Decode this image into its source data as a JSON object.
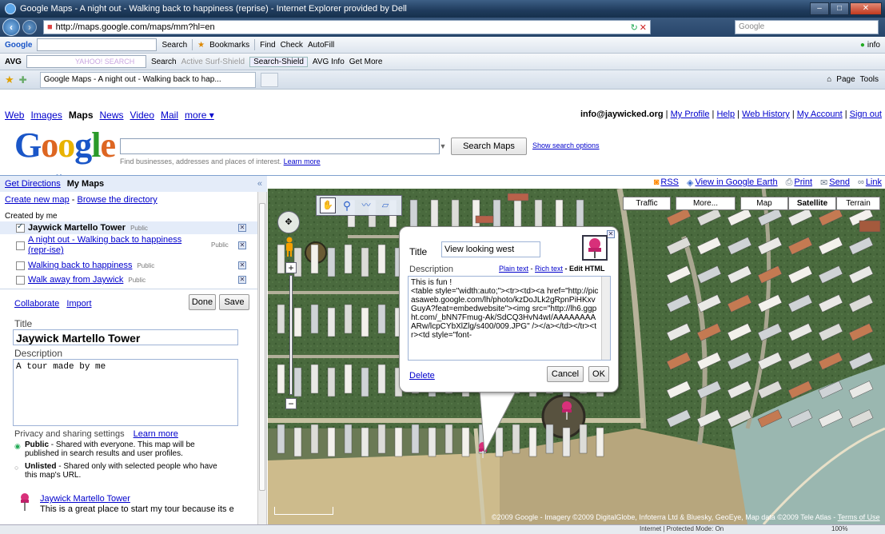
{
  "window": {
    "title": "Google Maps - A night out - Walking back to happiness (reprise) - Internet Explorer provided by Dell",
    "min": "–",
    "max": "□",
    "close": "✕"
  },
  "address": {
    "url": "http://maps.google.com/maps/mm?hl=en",
    "search_placeholder": "Google"
  },
  "toolbar1": {
    "google": "Google",
    "search": "Search",
    "bookmarks": "Bookmarks",
    "find": "Find",
    "check": "Check",
    "autofill": "AutoFill",
    "info": "info"
  },
  "toolbar2": {
    "avg": "AVG",
    "yahoo": "YAHOO! SEARCH",
    "search": "Search",
    "active": "Active Surf-Shield",
    "shield": "Search-Shield",
    "avginfo": "AVG Info",
    "getmore": "Get More"
  },
  "tabs": {
    "active": "Google Maps - A night out - Walking back to hap...",
    "page": "Page",
    "tools": "Tools"
  },
  "gnav": {
    "web": "Web",
    "images": "Images",
    "maps": "Maps",
    "news": "News",
    "video": "Video",
    "mail": "Mail",
    "more": "more ▾"
  },
  "user": {
    "email": "info@jaywicked.org",
    "links": [
      "My Profile",
      "Help",
      "Web History",
      "My Account",
      "Sign out"
    ]
  },
  "logo": {
    "text": "Google",
    "sub": "Maps"
  },
  "search": {
    "button": "Search Maps",
    "options": "Show search options",
    "hint": "Find businesses, addresses and places of interest.",
    "learn": "Learn more"
  },
  "panel": {
    "get_directions": "Get Directions",
    "my_maps": "My Maps",
    "create": "Create new map",
    "dash": " - ",
    "browse": "Browse the directory",
    "created_by": "Created by me",
    "maps": [
      {
        "name": "Jaywick Martello Tower",
        "badge": "Public"
      },
      {
        "name": "A night out - Walking back to happiness (repr-ise)",
        "badge": "Public"
      },
      {
        "name": "Walking back to happiness",
        "badge": "Public"
      },
      {
        "name": "Walk away from Jaywick",
        "badge": "Public"
      }
    ],
    "collaborate": "Collaborate",
    "import": "Import",
    "done": "Done",
    "save": "Save",
    "title_label": "Title",
    "title_value": "Jaywick Martello Tower",
    "desc_label": "Description",
    "desc_value": "A tour made by me",
    "privacy": "Privacy and sharing settings",
    "learn_more": "Learn more",
    "public_label": "Public",
    "public_text": " - Shared with everyone. This map will be published in search results  and user profiles.",
    "unlisted_label": "Unlisted",
    "unlisted_text": " - Shared only with selected people who have this map's URL.",
    "place_name": "Jaywick Martello Tower",
    "place_desc": "This is a great place to start my tour because its e"
  },
  "mapbar": {
    "rss": "RSS",
    "earth": "View in Google Earth",
    "print": "Print",
    "send": "Send",
    "link": "Link"
  },
  "maptypes": {
    "traffic": "Traffic",
    "more": "More...",
    "map": "Map",
    "satellite": "Satellite",
    "terrain": "Terrain"
  },
  "popup": {
    "title_label": "Title",
    "title_value": "View looking west",
    "desc_label": "Description",
    "plain": "Plain text",
    "dash": " - ",
    "rich": "Rich text",
    "edit": " - Edit HTML",
    "html": "This is fun !\n<table style=\"width:auto;\"><tr><td><a href=\"http://picasaweb.google.com/lh/photo/kzDoJLk2gRpnPiHKxvGuyA?feat=embedwebsite\"><img src=\"http://lh6.ggpht.com/_bNN7Fmug-Ak/SdCQ3HvN4wI/AAAAAAAAARw/lcpCYbXlZlg/s400/009.JPG\" /></a></td></tr><tr><td style=\"font-",
    "delete": "Delete",
    "cancel": "Cancel",
    "ok": "OK"
  },
  "copyright": "©2009 Google - Imagery ©2009 DigitalGlobe, Infoterra Ltd & Bluesky, GeoEye, Map data ©2009 Tele Atlas - ",
  "terms": "Terms of Use",
  "status": {
    "zone": "Internet | Protected Mode: On",
    "zoom": "100%"
  }
}
